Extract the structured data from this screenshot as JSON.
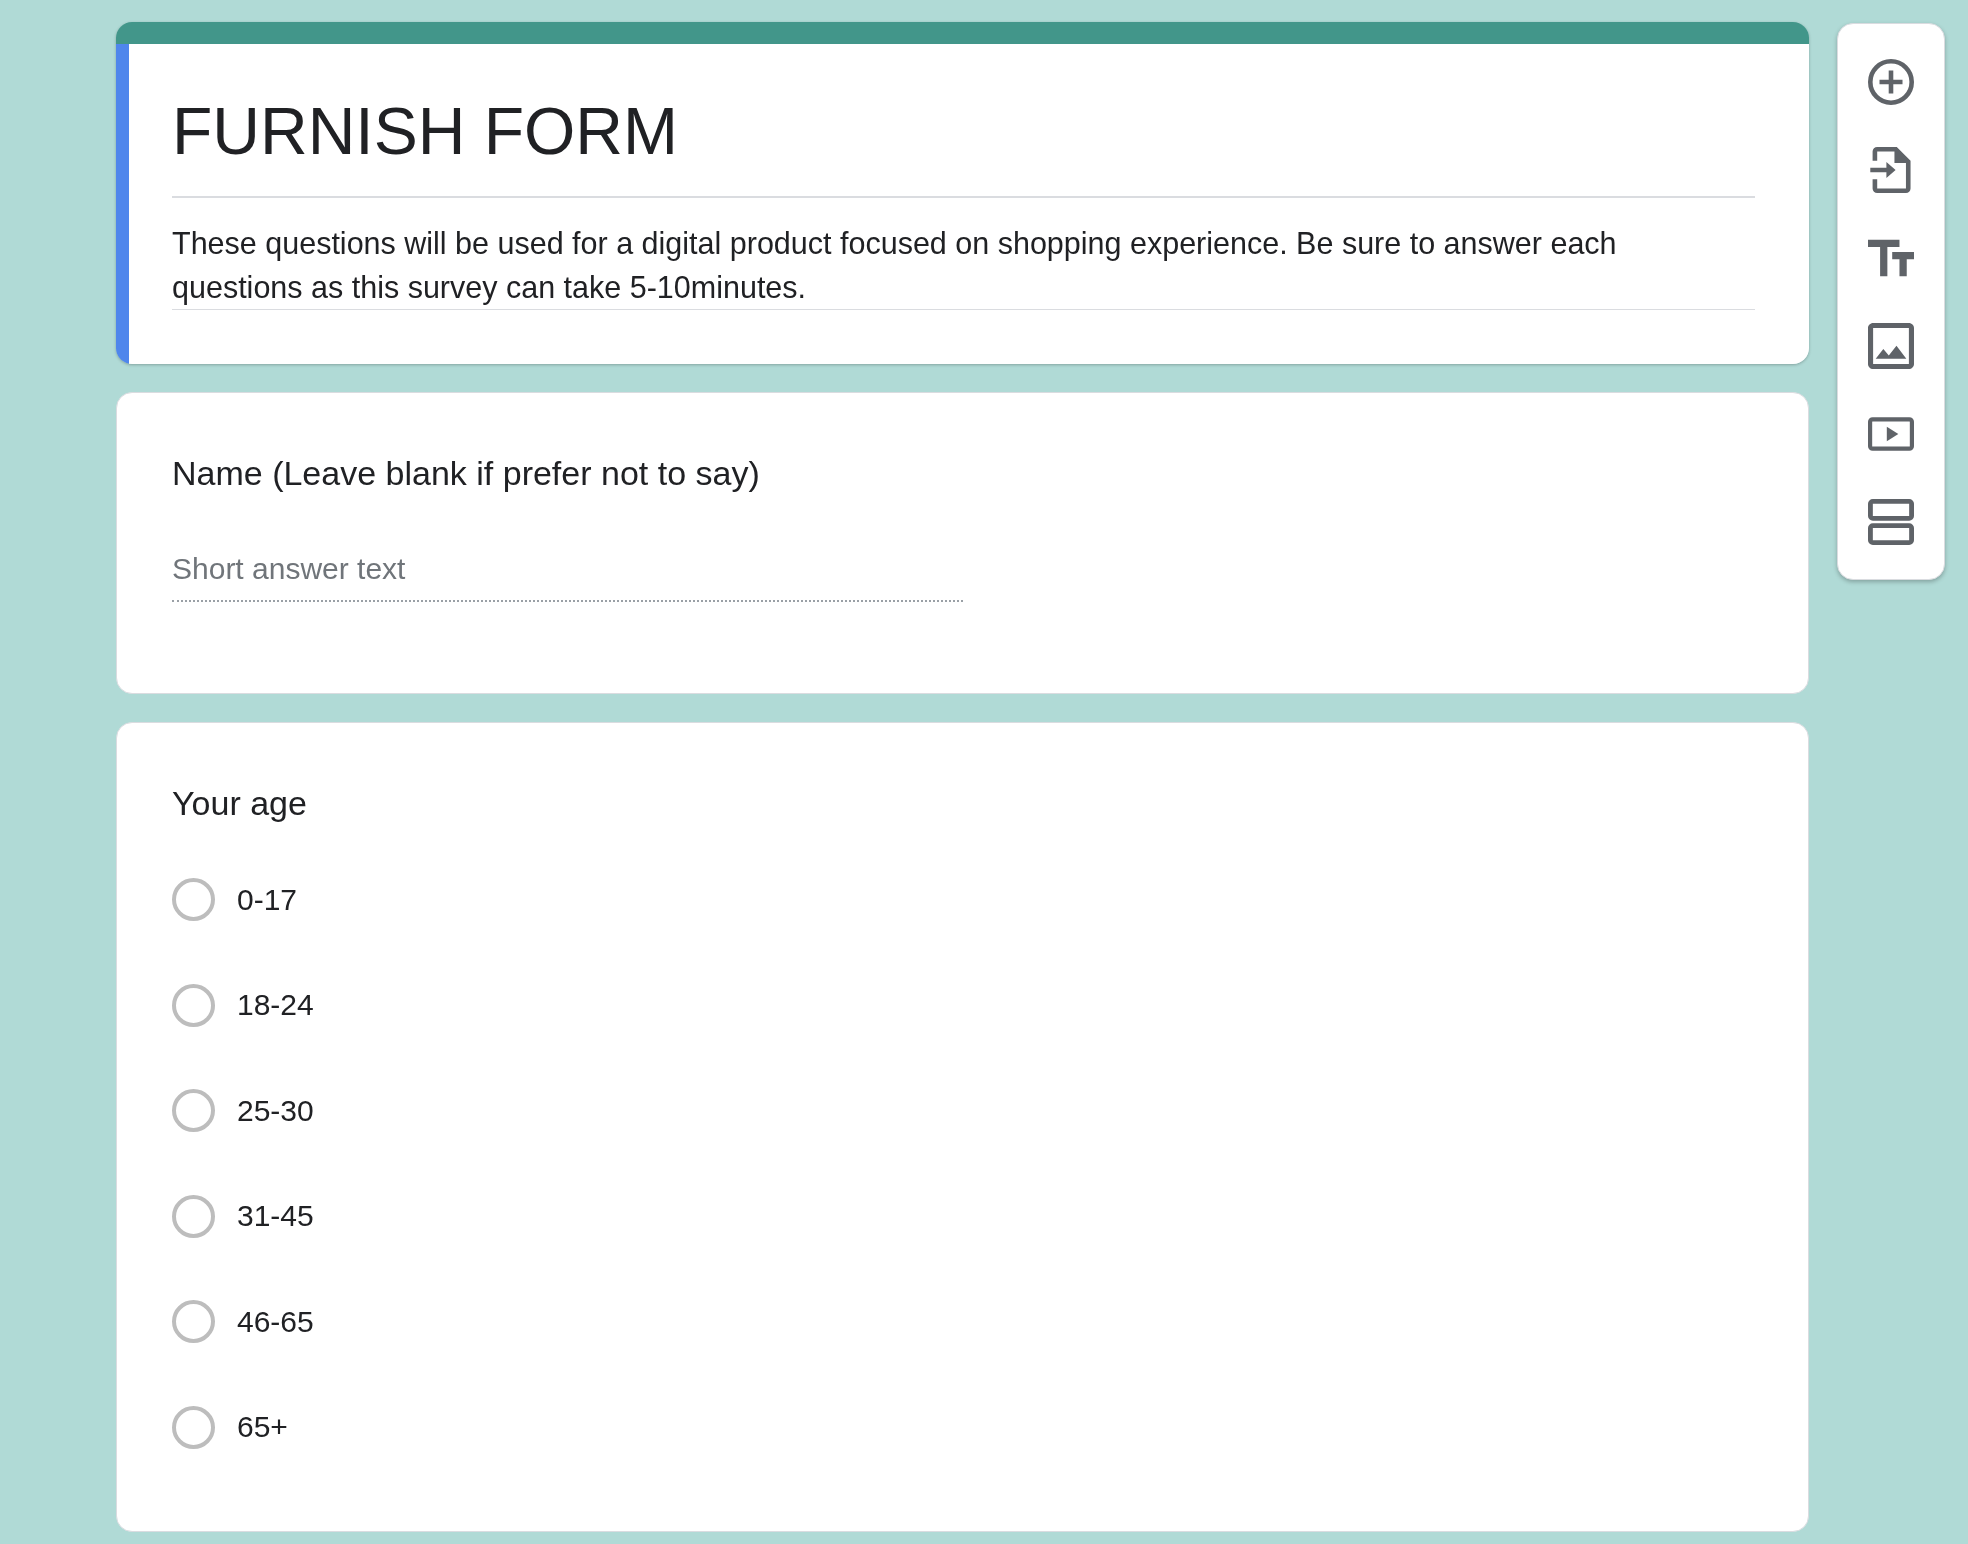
{
  "form_header": {
    "title": "FURNISH FORM",
    "description": "These questions will be used for a digital product focused on shopping experience. Be sure to answer each questions as this survey can take 5-10minutes."
  },
  "questions": [
    {
      "kind": "short_answer",
      "title": "Name (Leave blank if prefer not to say)",
      "placeholder": "Short answer text"
    },
    {
      "kind": "multiple_choice",
      "title": "Your age",
      "options": [
        {
          "label": "0-17",
          "selected": false
        },
        {
          "label": "18-24",
          "selected": false
        },
        {
          "label": "25-30",
          "selected": false
        },
        {
          "label": "31-45",
          "selected": false
        },
        {
          "label": "46-65",
          "selected": false
        },
        {
          "label": "65+",
          "selected": false
        }
      ]
    }
  ]
}
